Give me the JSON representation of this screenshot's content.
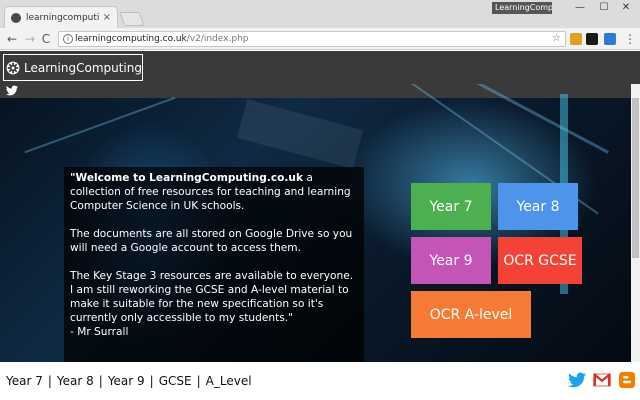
{
  "browser": {
    "tab_title": "learningcomputing.co.u",
    "tab_close": "×",
    "profile_badge": "LearningComputi...",
    "window_buttons": {
      "minimize": "—",
      "maximize": "☐",
      "close": "✕"
    },
    "nav": {
      "back": "←",
      "forward": "→",
      "reload": "C"
    },
    "url_host": "learningcomputing.co.uk",
    "url_path": "/v2/index.php",
    "star": "☆",
    "menu": "⋮"
  },
  "site": {
    "brand_name": "LearningComputing"
  },
  "welcome": {
    "quote_open": "\"",
    "headline": "Welcome to LearningComputing.co.uk",
    "line1_rest": " a collection of free resources for teaching and learning Computer Science in UK schools.",
    "para2": "The documents are all stored on Google Drive so you will need a Google account to access them.",
    "para3": "The Key Stage 3 resources are available to everyone. I am still reworking the GCSE and A-level material to make it suitable for the new specification so it's currently only accessible to my students.\"",
    "signature": "- Mr Surrall"
  },
  "tiles": [
    {
      "label": "Year 7",
      "color": "#4caf50"
    },
    {
      "label": "Year 8",
      "color": "#4d94ea"
    },
    {
      "label": "Year 9",
      "color": "#c455b6"
    },
    {
      "label": "OCR GCSE",
      "color": "#f44336"
    },
    {
      "label": "OCR A-level",
      "color": "#f47a36"
    }
  ],
  "footer": {
    "links": [
      "Year 7",
      "Year 8",
      "Year 9",
      "GCSE",
      "A_Level"
    ],
    "separator": "|"
  },
  "colors": {
    "header_bg": "#3a3a3a",
    "twitter": "#1da1f2",
    "gmail": "#d93025",
    "blogger": "#f57d00"
  },
  "icons": [
    "twitter-icon",
    "gear-icon",
    "gmail-icon",
    "blogger-icon"
  ]
}
